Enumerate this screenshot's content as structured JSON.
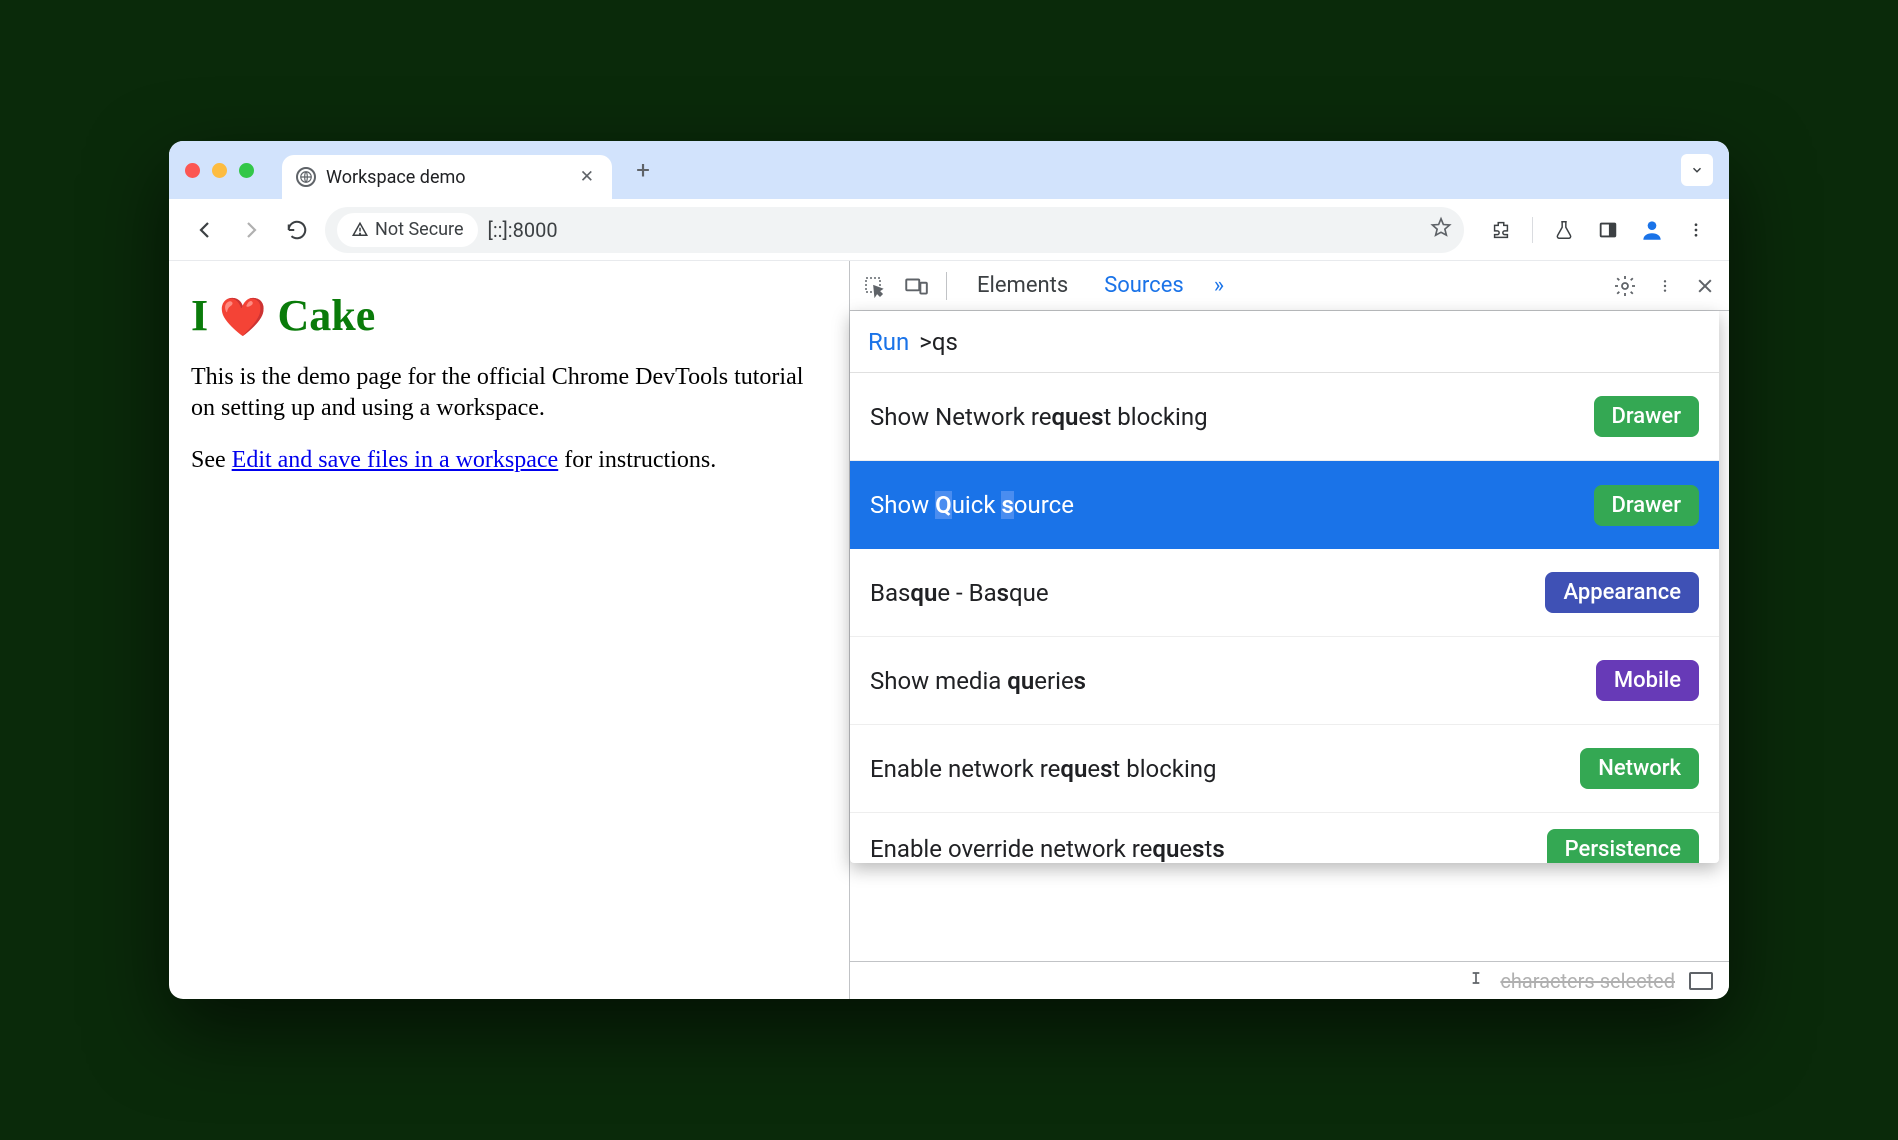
{
  "tab": {
    "title": "Workspace demo"
  },
  "omnibox": {
    "security_label": "Not Secure",
    "url": "[::]:8000"
  },
  "page": {
    "heading_prefix": "I",
    "heading_heart": "❤️",
    "heading_suffix": "Cake",
    "p1": "This is the demo page for the official Chrome DevTools tutorial on setting up and using a workspace.",
    "p2_prefix": "See ",
    "p2_link": "Edit and save files in a workspace",
    "p2_suffix": " for instructions."
  },
  "devtools": {
    "tabs": [
      "Elements",
      "Sources"
    ],
    "active_tab": "Sources"
  },
  "command_menu": {
    "run_label": "Run",
    "query": ">qs",
    "items": [
      {
        "parts": [
          "Show Network re",
          "qu",
          "e",
          "s",
          "t blocking"
        ],
        "badge": "Drawer",
        "badge_class": "bd-drawer",
        "selected": false
      },
      {
        "parts": [
          "Show ",
          "Q",
          "uick ",
          "s",
          "ource"
        ],
        "badge": "Drawer",
        "badge_class": "bd-drawer",
        "selected": true
      },
      {
        "parts": [
          "Bas",
          "qu",
          "e - Ba",
          "s",
          "que"
        ],
        "badge": "Appearance",
        "badge_class": "bd-appearance",
        "selected": false
      },
      {
        "parts": [
          "Show media ",
          "qu",
          "erie",
          "s",
          ""
        ],
        "badge": "Mobile",
        "badge_class": "bd-mobile",
        "selected": false
      },
      {
        "parts": [
          "Enable network re",
          "qu",
          "e",
          "s",
          "t blocking"
        ],
        "badge": "Network",
        "badge_class": "bd-network",
        "selected": false
      },
      {
        "parts": [
          "Enable override network re",
          "qu",
          "e",
          "s",
          "t",
          "s",
          ""
        ],
        "badge": "Persistence",
        "badge_class": "bd-persistence",
        "selected": false
      }
    ]
  },
  "statusbar": {
    "text": "characters selected"
  }
}
